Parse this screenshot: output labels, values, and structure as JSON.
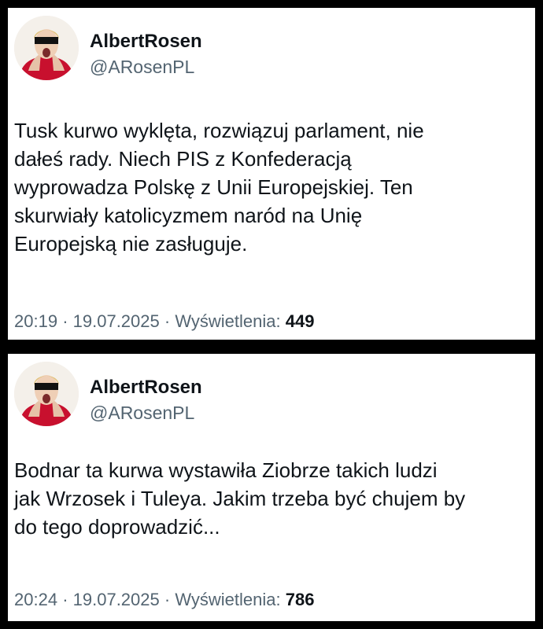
{
  "tweets": [
    {
      "author": {
        "display_name": "AlbertRosen",
        "handle": "@ARosenPL",
        "avatar_icon": "profile-avatar-icon"
      },
      "text_lines": [
        "Tusk kurwo wyklęta, rozwiązuj parlament, nie",
        "dałeś rady. Niech PIS z Konfederacją",
        "wyprowadza Polskę z Unii Europejskiej. Ten",
        "skurwiały katolicyzmem naród na Unię",
        "Europejską nie zasługuje."
      ],
      "time": "20:19",
      "date": "19.07.2025",
      "views_label": "Wyświetlenia:",
      "views_count": "449",
      "separator": "·"
    },
    {
      "author": {
        "display_name": "AlbertRosen",
        "handle": "@ARosenPL",
        "avatar_icon": "profile-avatar-icon"
      },
      "text_lines": [
        "Bodnar ta kurwa wystawiła Ziobrze takich ludzi",
        "jak Wrzosek i Tuleya. Jakim trzeba być chujem by",
        "do tego doprowadzić..."
      ],
      "time": "20:24",
      "date": "19.07.2025",
      "views_label": "Wyświetlenia:",
      "views_count": "786",
      "separator": "·"
    }
  ],
  "colors": {
    "background": "#000000",
    "card": "#ffffff",
    "text_primary": "#0f1419",
    "text_secondary": "#536471"
  }
}
